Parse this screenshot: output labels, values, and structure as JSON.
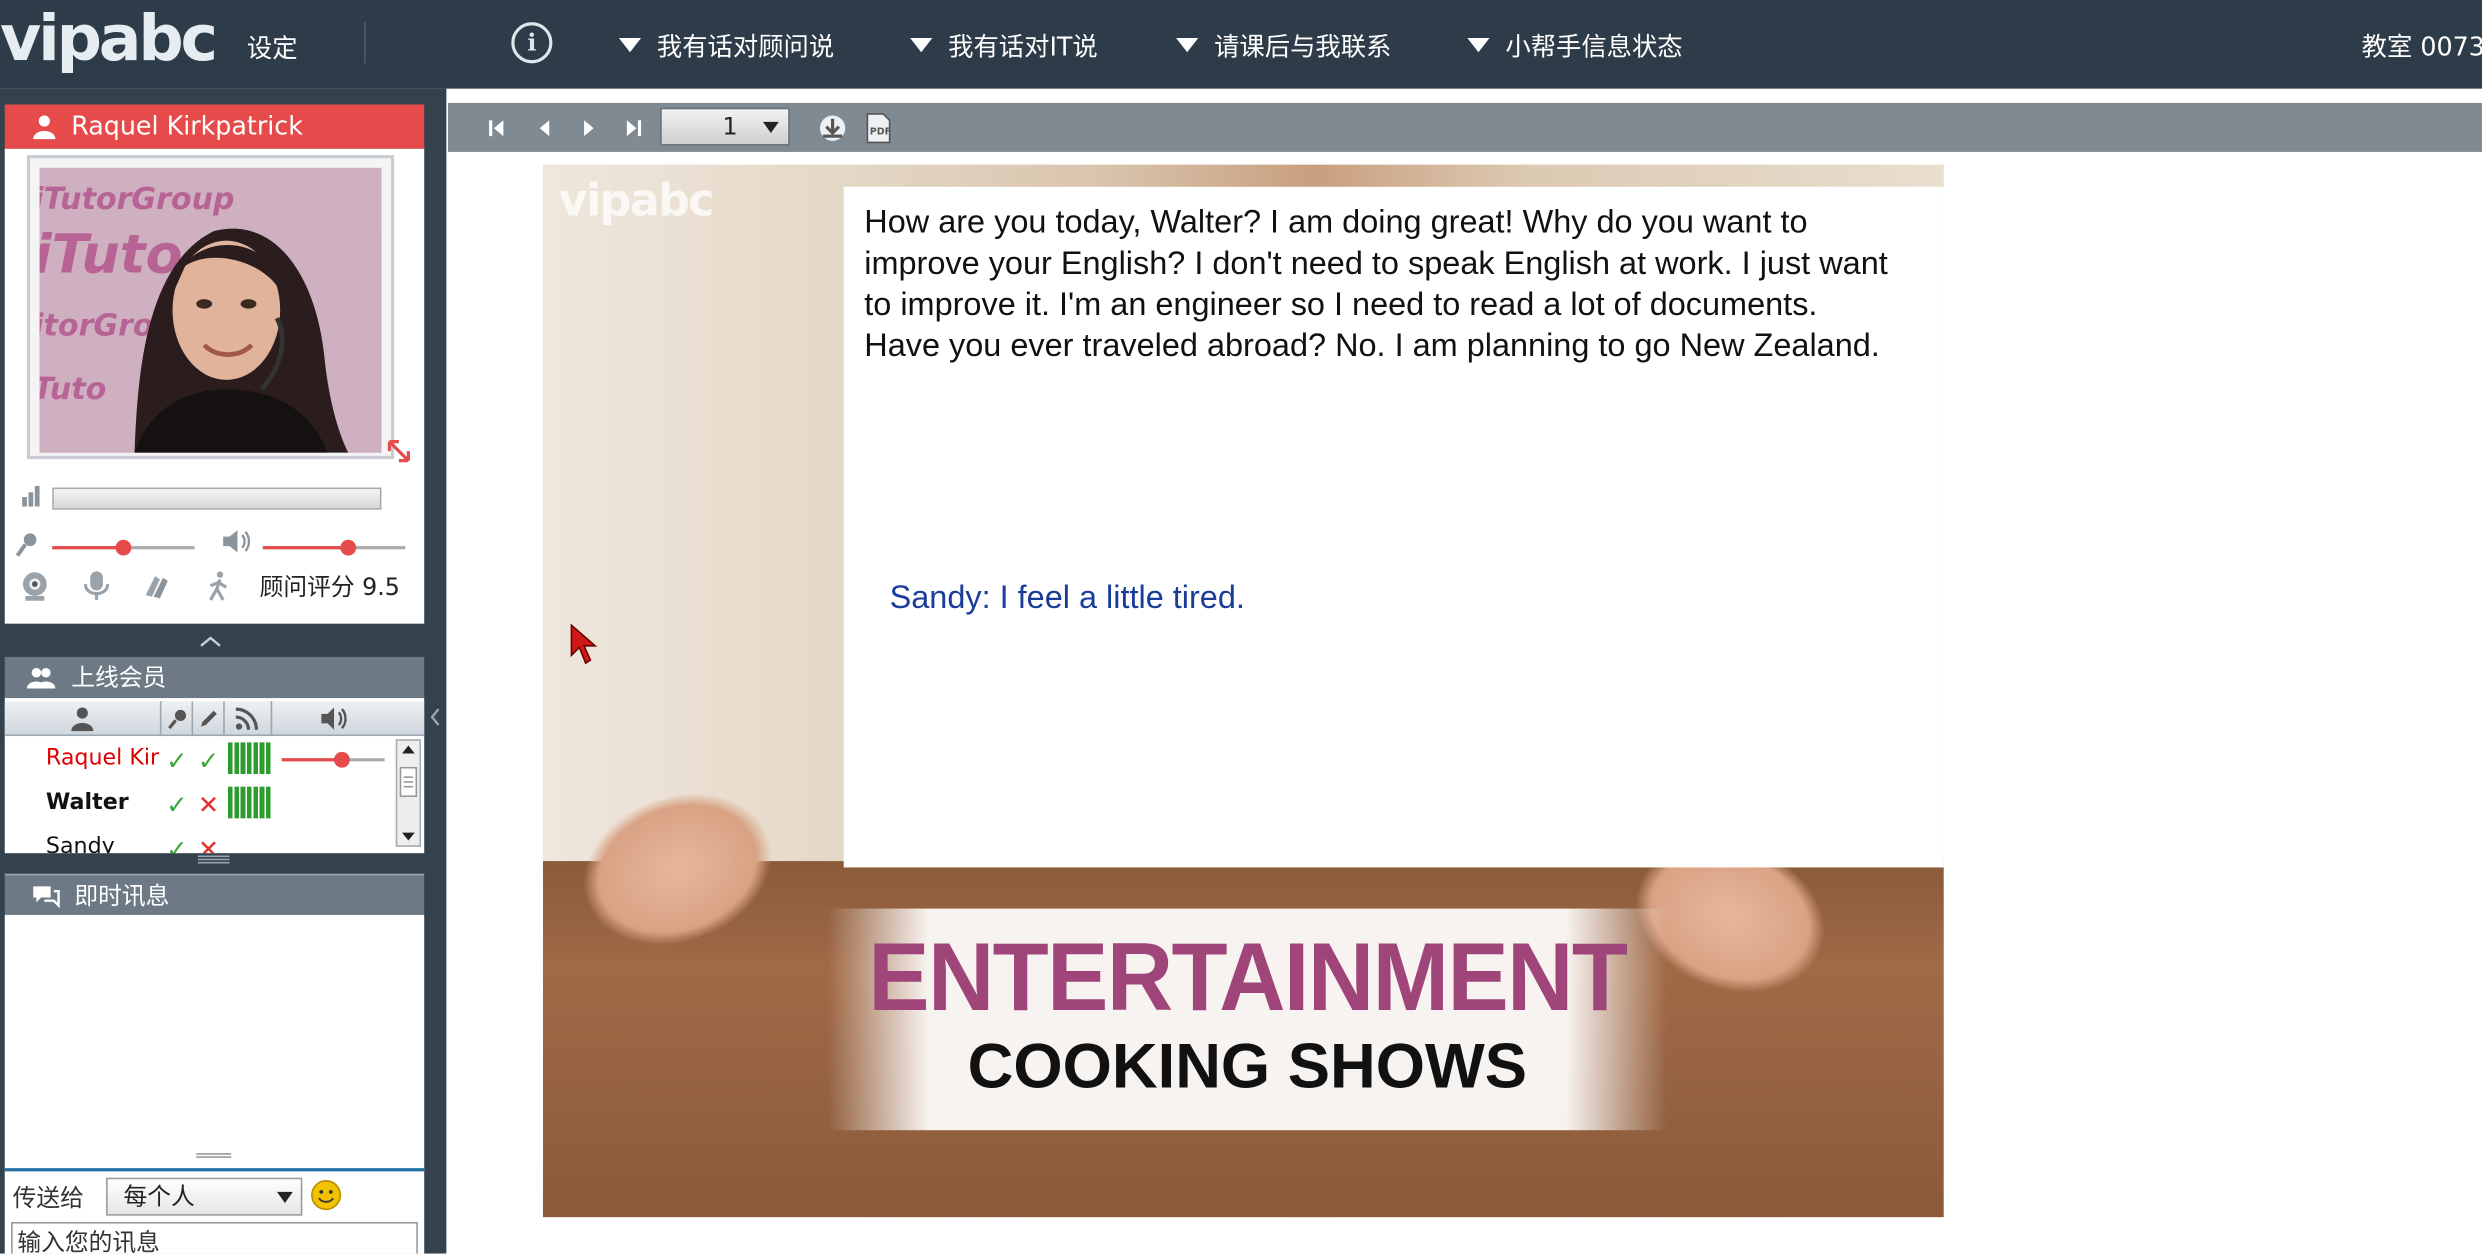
{
  "topbar": {
    "logo": "vipabc",
    "settings": "设定",
    "menus": [
      "我有话对顾问说",
      "我有话对IT说",
      "请课后与我联系",
      "小帮手信息状态"
    ],
    "room": "教室 0073"
  },
  "teacher": {
    "name": "Raquel Kirkpatrick",
    "photo_watermark": "iTutorGroup",
    "mic_volume": 0.5,
    "speaker_volume": 0.6,
    "rating_label": "顾问评分 9.5"
  },
  "members": {
    "title": "上线会员",
    "rows": [
      {
        "name": "Raquel Kir",
        "mic": "check",
        "pen": "check",
        "color": "#e00000",
        "bold": false
      },
      {
        "name": "Walter",
        "mic": "check",
        "pen": "cross",
        "color": "#111111",
        "bold": true
      },
      {
        "name": "Sandy",
        "mic": "check",
        "pen": "cross",
        "color": "#111111",
        "bold": false
      }
    ]
  },
  "im": {
    "title": "即时讯息",
    "send_to_label": "传送给",
    "send_to_value": "每个人",
    "input_placeholder": "输入您的讯息"
  },
  "whiteboard": {
    "page": "1",
    "pdf_label": "PDF"
  },
  "slide": {
    "logo": "vipabc",
    "paragraph": "How are you today, Walter? I am doing great! Why do you want to improve your English? I don't need to speak English at work. I just want to improve it. I'm an engineer so I need to read a lot of documents. Have you ever traveled abroad? No. I am planning to go New Zealand.",
    "sandy_line": "Sandy: I feel a little tired.",
    "title_top": "ENTERTAINMENT",
    "title_bottom": "COOKING SHOWS"
  }
}
